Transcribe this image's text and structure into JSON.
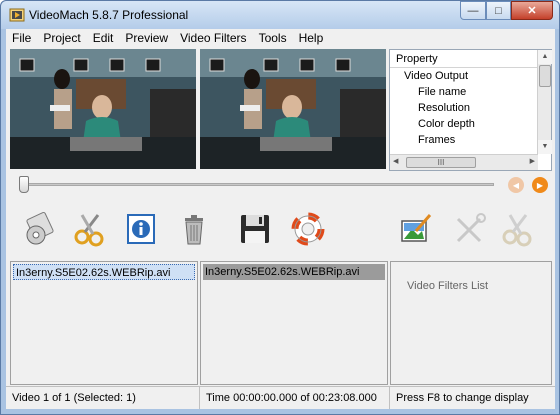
{
  "titlebar": {
    "title": "VideoMach 5.8.7 Professional"
  },
  "window_controls": {
    "minimize": "—",
    "maximize": "□",
    "close": "✕"
  },
  "menu": [
    "File",
    "Project",
    "Edit",
    "Preview",
    "Video Filters",
    "Tools",
    "Help"
  ],
  "properties": {
    "header": "Property",
    "rows": [
      {
        "label": "Video Output",
        "level": 1
      },
      {
        "label": "File name",
        "level": 2
      },
      {
        "label": "Resolution",
        "level": 2
      },
      {
        "label": "Color depth",
        "level": 2
      },
      {
        "label": "Frames",
        "level": 2
      }
    ],
    "hscroll_thumb": "III"
  },
  "timeline": {
    "position": 0
  },
  "toolbar": [
    "open-media-icon",
    "cut-icon",
    "info-icon",
    "delete-icon",
    "save-icon",
    "help-lifebuoy-icon",
    "edit-image-icon",
    "tools-icon",
    "scissors-disabled-icon"
  ],
  "lists": {
    "input_item": "In3erny.S5E02.62s.WEBRip.avi",
    "output_item": "In3erny.S5E02.62s.WEBRip.avi",
    "filters_label": "Video Filters List"
  },
  "status": {
    "video_count": "Video 1 of 1  (Selected: 1)",
    "time": "Time 00:00:00.000 of 00:23:08.000",
    "hint": "Press F8 to change display"
  },
  "colors": {
    "selection_blue": "#cfe0f5",
    "selection_gray": "#9b9b9b",
    "accent_orange": "#f08a1a"
  }
}
